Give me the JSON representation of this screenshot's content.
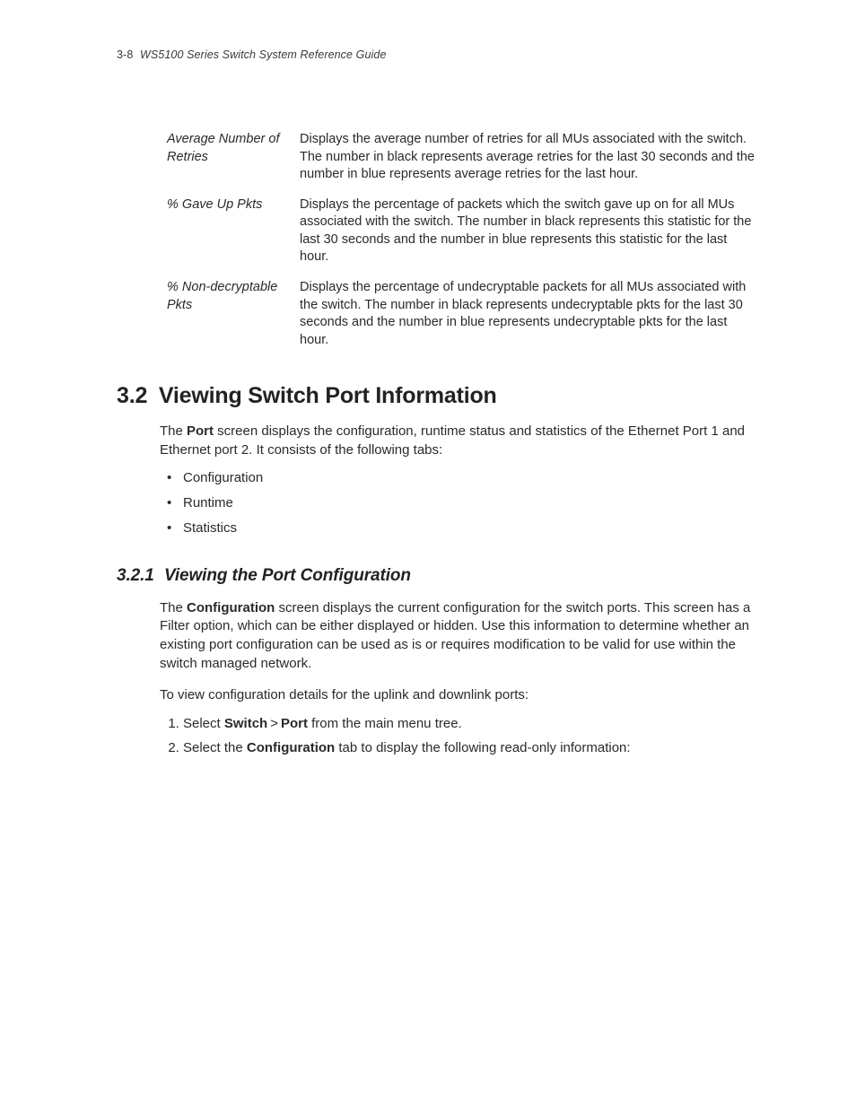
{
  "header": {
    "page_number": "3-8",
    "book_title": "WS5100 Series Switch System Reference Guide"
  },
  "definitions": [
    {
      "term": "Average Number of Retries",
      "desc": "Displays the average number of retries for all MUs associated with the switch. The number in black represents average retries for the last 30 seconds and the number in blue represents average retries for the last hour."
    },
    {
      "term": "% Gave Up Pkts",
      "desc": "Displays the percentage of packets which the switch gave up on for all MUs associated with the switch. The number in black represents this statistic for the last 30 seconds and the number in blue represents this statistic for the last hour."
    },
    {
      "term": "% Non-decryptable Pkts",
      "desc": "Displays the percentage of undecryptable packets for all MUs associated with the switch. The number in black represents undecryptable pkts for the last 30 seconds and the number in blue represents undecryptable pkts for the last hour."
    }
  ],
  "section_3_2": {
    "number": "3.2",
    "title": "Viewing Switch Port Information",
    "intro_pre": "The ",
    "intro_kw": "Port",
    "intro_post": " screen displays the configuration, runtime status and statistics of the Ethernet Port 1 and Ethernet port 2. It consists of the following tabs:",
    "bullets": [
      "Configuration",
      "Runtime",
      "Statistics"
    ]
  },
  "section_3_2_1": {
    "number": "3.2.1",
    "title": "Viewing the Port Configuration",
    "p1_pre": "The ",
    "p1_kw": "Configuration",
    "p1_post": " screen displays the current configuration for the switch ports. This screen has a Filter option, which can be either displayed or hidden. Use this information to determine whether an existing port configuration can be used as is or requires modification to be valid for use within the switch managed network.",
    "p2": "To view configuration details for the uplink and downlink ports:",
    "step1_pre": "Select ",
    "step1_kw1": "Switch",
    "step1_sep": ">",
    "step1_kw2": "Port",
    "step1_post": " from the main menu tree.",
    "step2_pre": "Select the ",
    "step2_kw": "Configuration",
    "step2_post": " tab to display the following read-only information:"
  }
}
